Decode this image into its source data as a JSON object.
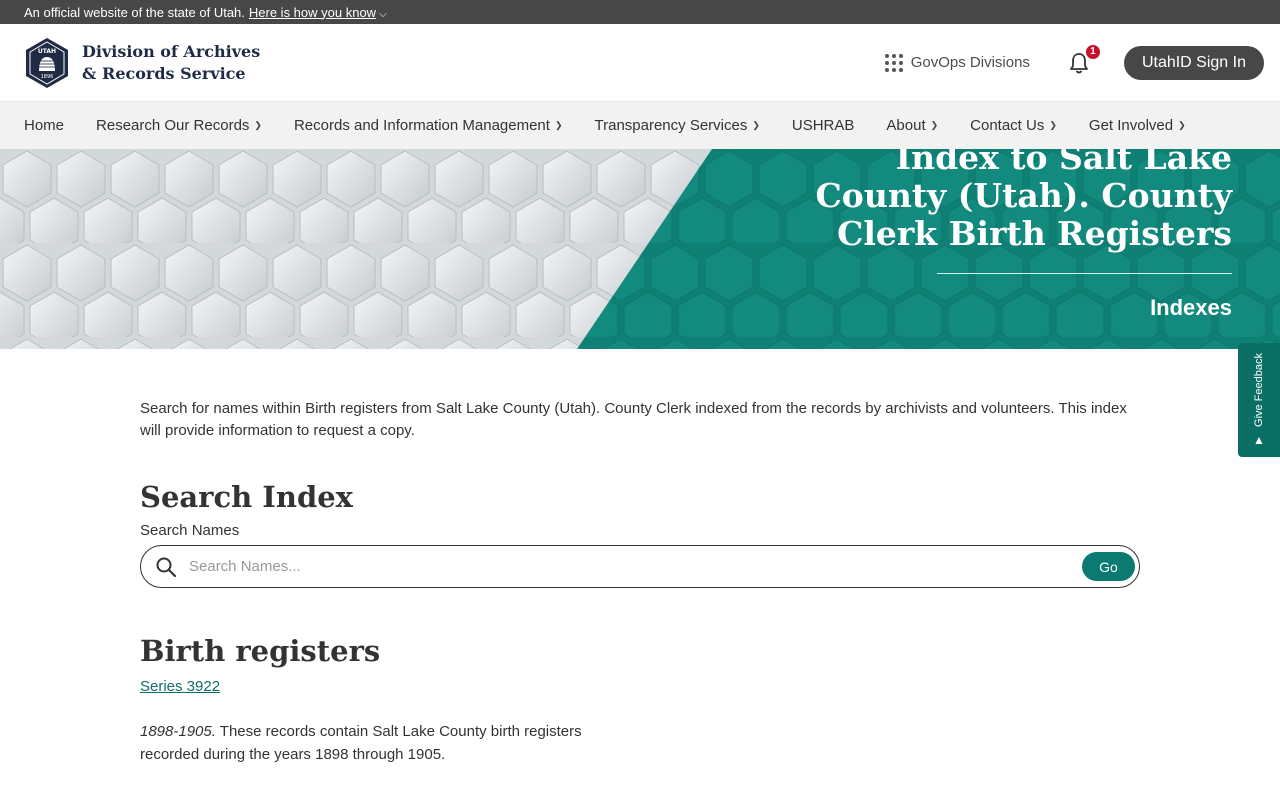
{
  "gov_banner": {
    "text": "An official website of the state of Utah.",
    "link": "Here is how you know"
  },
  "header": {
    "brand_line1": "Division of Archives",
    "brand_line2": "& Records Service",
    "seal_text_top": "UTAH",
    "seal_text_bottom": "1896",
    "govops_label": "GovOps Divisions",
    "notification_count": "1",
    "signin_label": "UtahID Sign In"
  },
  "nav": {
    "items": [
      {
        "label": "Home",
        "dropdown": false
      },
      {
        "label": "Research Our Records",
        "dropdown": true
      },
      {
        "label": "Records and Information Management",
        "dropdown": true
      },
      {
        "label": "Transparency Services",
        "dropdown": true
      },
      {
        "label": "USHRAB",
        "dropdown": false
      },
      {
        "label": "About",
        "dropdown": true
      },
      {
        "label": "Contact Us",
        "dropdown": true
      },
      {
        "label": "Get Involved",
        "dropdown": true
      }
    ]
  },
  "hero": {
    "title": "Index to Salt Lake County (Utah). County Clerk Birth Registers",
    "subtitle": "Indexes"
  },
  "feedback": {
    "label": "Give Feedback"
  },
  "main": {
    "intro": "Search for names within Birth registers from Salt Lake County (Utah). County Clerk indexed from the records by archivists and volunteers. This index will provide information to request a copy.",
    "search_title": "Search Index",
    "search_label": "Search Names",
    "search_placeholder": "Search Names...",
    "go_label": "Go",
    "section_title": "Birth registers",
    "series_link": "Series 3922",
    "desc_dates": "1898-1905.",
    "desc_text": " These records contain Salt Lake County birth registers recorded during the years 1898 through 1905."
  },
  "colors": {
    "teal": "#0b7a71",
    "banner_gray": "#474747",
    "nav_bg": "#f2f2f2",
    "navy": "#1f2a44"
  }
}
